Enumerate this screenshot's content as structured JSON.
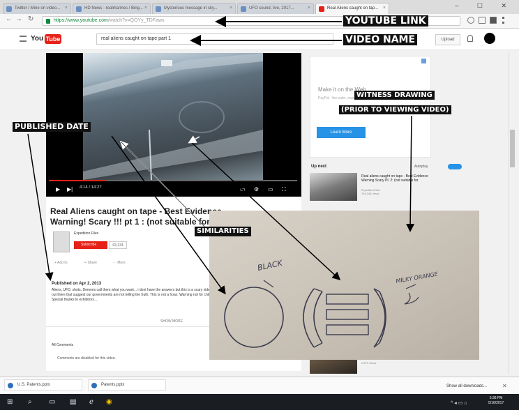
{
  "browser": {
    "tabs": [
      {
        "label": "Twitter / Mine on video...",
        "active": false
      },
      {
        "label": "HD News - realmarines / Bing...",
        "active": false
      },
      {
        "label": "Mysterious message in sky...",
        "active": false
      },
      {
        "label": "UFO sound, live, 2017...",
        "active": false
      },
      {
        "label": "Real Aliens caught on tap...",
        "active": true
      }
    ],
    "window_controls": "– ☐ ✕",
    "url_host": "https://www.youtube.com",
    "url_path": "/watch?v=QOYy_TDFaws"
  },
  "youtube": {
    "logo_you": "You",
    "logo_tube": "Tube",
    "search_value": "real aliens caught on tape part 1",
    "upload_label": "Upload"
  },
  "video": {
    "timecode": "4:14 / 14:27",
    "progress": 0.23,
    "title": "Real Aliens caught on tape - Best Evidence Warning! Scary !!! pt 1 : (not suitable for Children)",
    "channel_name": "Expedition Files",
    "subscribe_label": "Subscribe",
    "subscriber_count": "63,134",
    "actions": [
      "+ Add to",
      "↪ Share",
      "··· More"
    ],
    "published": "Published on Apr 2, 2013",
    "description": "Aliens, UFO, shots, Demons call them what you want... i dont have the answers but this is a scary video. This is a lot of Evidence out there that suggest our governments are not telling the truth. This is not a hoax. Warning not for children as its a little scary. Special thanks to exhibitors...",
    "show_more": "SHOW MORE",
    "comments_heading": "All Comments",
    "comments_disabled": "Comments are disabled for this video."
  },
  "sidebar": {
    "ad_title": "Make it on the Web",
    "ad_text": "PayPal · the safer, easier way to pay online",
    "ad_button": "Learn More",
    "up_next": "Up next",
    "autoplay": "Autoplay",
    "suggestion_1_title": "Real aliens caught on tape - Best Evidence Warning Scary Pt. 2: (not suitable for",
    "suggestion_1_channel": "ExpeditionFiles",
    "suggestion_1_views": "749,346 views",
    "suggestion_2_meta": "2,879 views"
  },
  "downloads": {
    "items": [
      "U.S. Patents.pptx",
      "Patents.pptx"
    ],
    "show_all": "Show all downloads..."
  },
  "taskbar": {
    "time": "5:36 PM",
    "date": "5/16/2017"
  },
  "drawing": {
    "handwritten_1": "BLACK",
    "handwritten_2": "MILKY ORANGE"
  },
  "annotations": {
    "youtube_link": "YOUTUBE LINK",
    "video_name": "VIDEO NAME",
    "witness_line1": "WITNESS DRAWING",
    "witness_line2": "(PRIOR TO VIEWING VIDEO)",
    "published_date": "PUBLISHED DATE",
    "similarities": "SIMILARITIES"
  },
  "colors": {
    "youtube_red": "#e62117",
    "ad_blue": "#2793e6",
    "taskbar": "#1a1d22"
  }
}
